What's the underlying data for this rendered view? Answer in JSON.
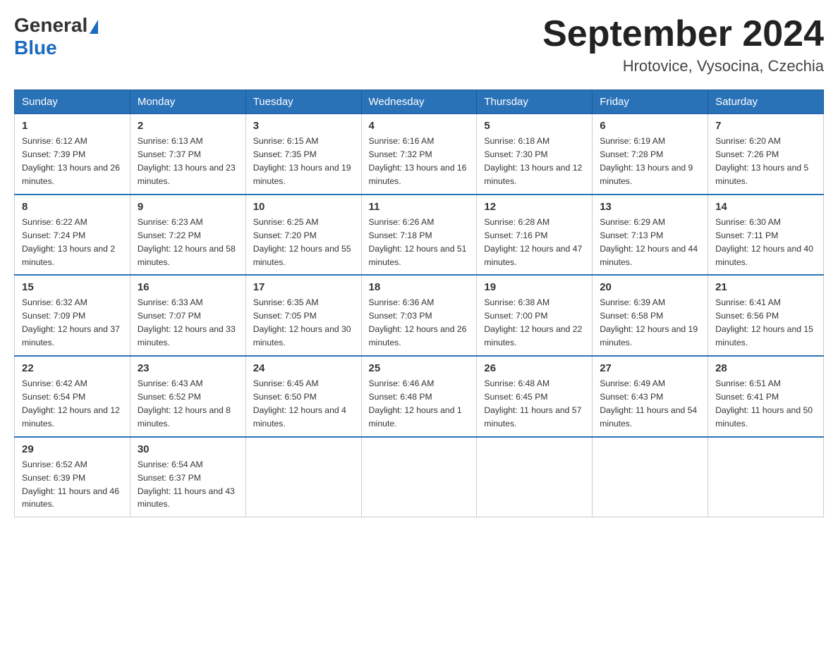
{
  "logo": {
    "text_general": "General",
    "text_blue": "Blue"
  },
  "header": {
    "month_year": "September 2024",
    "location": "Hrotovice, Vysocina, Czechia"
  },
  "days_of_week": [
    "Sunday",
    "Monday",
    "Tuesday",
    "Wednesday",
    "Thursday",
    "Friday",
    "Saturday"
  ],
  "weeks": [
    [
      {
        "day": "1",
        "sunrise": "6:12 AM",
        "sunset": "7:39 PM",
        "daylight": "13 hours and 26 minutes."
      },
      {
        "day": "2",
        "sunrise": "6:13 AM",
        "sunset": "7:37 PM",
        "daylight": "13 hours and 23 minutes."
      },
      {
        "day": "3",
        "sunrise": "6:15 AM",
        "sunset": "7:35 PM",
        "daylight": "13 hours and 19 minutes."
      },
      {
        "day": "4",
        "sunrise": "6:16 AM",
        "sunset": "7:32 PM",
        "daylight": "13 hours and 16 minutes."
      },
      {
        "day": "5",
        "sunrise": "6:18 AM",
        "sunset": "7:30 PM",
        "daylight": "13 hours and 12 minutes."
      },
      {
        "day": "6",
        "sunrise": "6:19 AM",
        "sunset": "7:28 PM",
        "daylight": "13 hours and 9 minutes."
      },
      {
        "day": "7",
        "sunrise": "6:20 AM",
        "sunset": "7:26 PM",
        "daylight": "13 hours and 5 minutes."
      }
    ],
    [
      {
        "day": "8",
        "sunrise": "6:22 AM",
        "sunset": "7:24 PM",
        "daylight": "13 hours and 2 minutes."
      },
      {
        "day": "9",
        "sunrise": "6:23 AM",
        "sunset": "7:22 PM",
        "daylight": "12 hours and 58 minutes."
      },
      {
        "day": "10",
        "sunrise": "6:25 AM",
        "sunset": "7:20 PM",
        "daylight": "12 hours and 55 minutes."
      },
      {
        "day": "11",
        "sunrise": "6:26 AM",
        "sunset": "7:18 PM",
        "daylight": "12 hours and 51 minutes."
      },
      {
        "day": "12",
        "sunrise": "6:28 AM",
        "sunset": "7:16 PM",
        "daylight": "12 hours and 47 minutes."
      },
      {
        "day": "13",
        "sunrise": "6:29 AM",
        "sunset": "7:13 PM",
        "daylight": "12 hours and 44 minutes."
      },
      {
        "day": "14",
        "sunrise": "6:30 AM",
        "sunset": "7:11 PM",
        "daylight": "12 hours and 40 minutes."
      }
    ],
    [
      {
        "day": "15",
        "sunrise": "6:32 AM",
        "sunset": "7:09 PM",
        "daylight": "12 hours and 37 minutes."
      },
      {
        "day": "16",
        "sunrise": "6:33 AM",
        "sunset": "7:07 PM",
        "daylight": "12 hours and 33 minutes."
      },
      {
        "day": "17",
        "sunrise": "6:35 AM",
        "sunset": "7:05 PM",
        "daylight": "12 hours and 30 minutes."
      },
      {
        "day": "18",
        "sunrise": "6:36 AM",
        "sunset": "7:03 PM",
        "daylight": "12 hours and 26 minutes."
      },
      {
        "day": "19",
        "sunrise": "6:38 AM",
        "sunset": "7:00 PM",
        "daylight": "12 hours and 22 minutes."
      },
      {
        "day": "20",
        "sunrise": "6:39 AM",
        "sunset": "6:58 PM",
        "daylight": "12 hours and 19 minutes."
      },
      {
        "day": "21",
        "sunrise": "6:41 AM",
        "sunset": "6:56 PM",
        "daylight": "12 hours and 15 minutes."
      }
    ],
    [
      {
        "day": "22",
        "sunrise": "6:42 AM",
        "sunset": "6:54 PM",
        "daylight": "12 hours and 12 minutes."
      },
      {
        "day": "23",
        "sunrise": "6:43 AM",
        "sunset": "6:52 PM",
        "daylight": "12 hours and 8 minutes."
      },
      {
        "day": "24",
        "sunrise": "6:45 AM",
        "sunset": "6:50 PM",
        "daylight": "12 hours and 4 minutes."
      },
      {
        "day": "25",
        "sunrise": "6:46 AM",
        "sunset": "6:48 PM",
        "daylight": "12 hours and 1 minute."
      },
      {
        "day": "26",
        "sunrise": "6:48 AM",
        "sunset": "6:45 PM",
        "daylight": "11 hours and 57 minutes."
      },
      {
        "day": "27",
        "sunrise": "6:49 AM",
        "sunset": "6:43 PM",
        "daylight": "11 hours and 54 minutes."
      },
      {
        "day": "28",
        "sunrise": "6:51 AM",
        "sunset": "6:41 PM",
        "daylight": "11 hours and 50 minutes."
      }
    ],
    [
      {
        "day": "29",
        "sunrise": "6:52 AM",
        "sunset": "6:39 PM",
        "daylight": "11 hours and 46 minutes."
      },
      {
        "day": "30",
        "sunrise": "6:54 AM",
        "sunset": "6:37 PM",
        "daylight": "11 hours and 43 minutes."
      },
      null,
      null,
      null,
      null,
      null
    ]
  ],
  "labels": {
    "sunrise": "Sunrise:",
    "sunset": "Sunset:",
    "daylight": "Daylight:"
  }
}
